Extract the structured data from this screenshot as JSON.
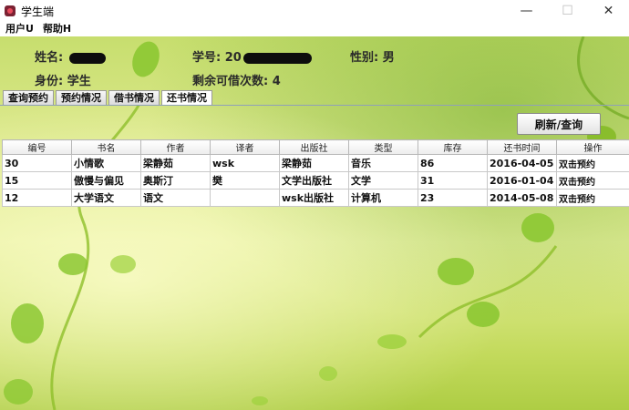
{
  "window": {
    "title": "学生端"
  },
  "menu": [
    {
      "label": "用户U"
    },
    {
      "label": "帮助H"
    }
  ],
  "info": {
    "name_label": "姓名:",
    "student_id_label": "学号:",
    "student_id_visible_prefix": "20",
    "gender_label": "性别:",
    "gender_value": "男",
    "identity_label": "身份:",
    "identity_value": "学生",
    "remaining_label": "剩余可借次数:",
    "remaining_value": "4"
  },
  "tabs": [
    {
      "label": "查询预约"
    },
    {
      "label": "预约情况"
    },
    {
      "label": "借书情况"
    },
    {
      "label": "还书情况",
      "active": true
    }
  ],
  "refresh_button": {
    "label": "刷新/查询"
  },
  "table": {
    "headers": [
      "编号",
      "书名",
      "作者",
      "译者",
      "出版社",
      "类型",
      "库存",
      "还书时间",
      "操作"
    ],
    "rows": [
      [
        "30",
        "小情歌",
        "梁静茹",
        "wsk",
        "梁静茹",
        "音乐",
        "86",
        "2016-04-05",
        "双击预约"
      ],
      [
        "15",
        "傲慢与偏见",
        "奥斯汀",
        "樊",
        "文学出版社",
        "文学",
        "31",
        "2016-01-04",
        "双击预约"
      ],
      [
        "12",
        "大学语文",
        "语文",
        "",
        "wsk出版社",
        "计算机",
        "23",
        "2014-05-08",
        "双击预约"
      ]
    ]
  },
  "colors": {
    "background_green": "#c7de6e",
    "leaf_green": "#7fb81e",
    "tab_border": "#9a9a9a"
  },
  "icons": {
    "app": "book-app-icon",
    "minimize": "minimize-icon",
    "maximize": "maximize-icon",
    "close": "close-icon"
  }
}
